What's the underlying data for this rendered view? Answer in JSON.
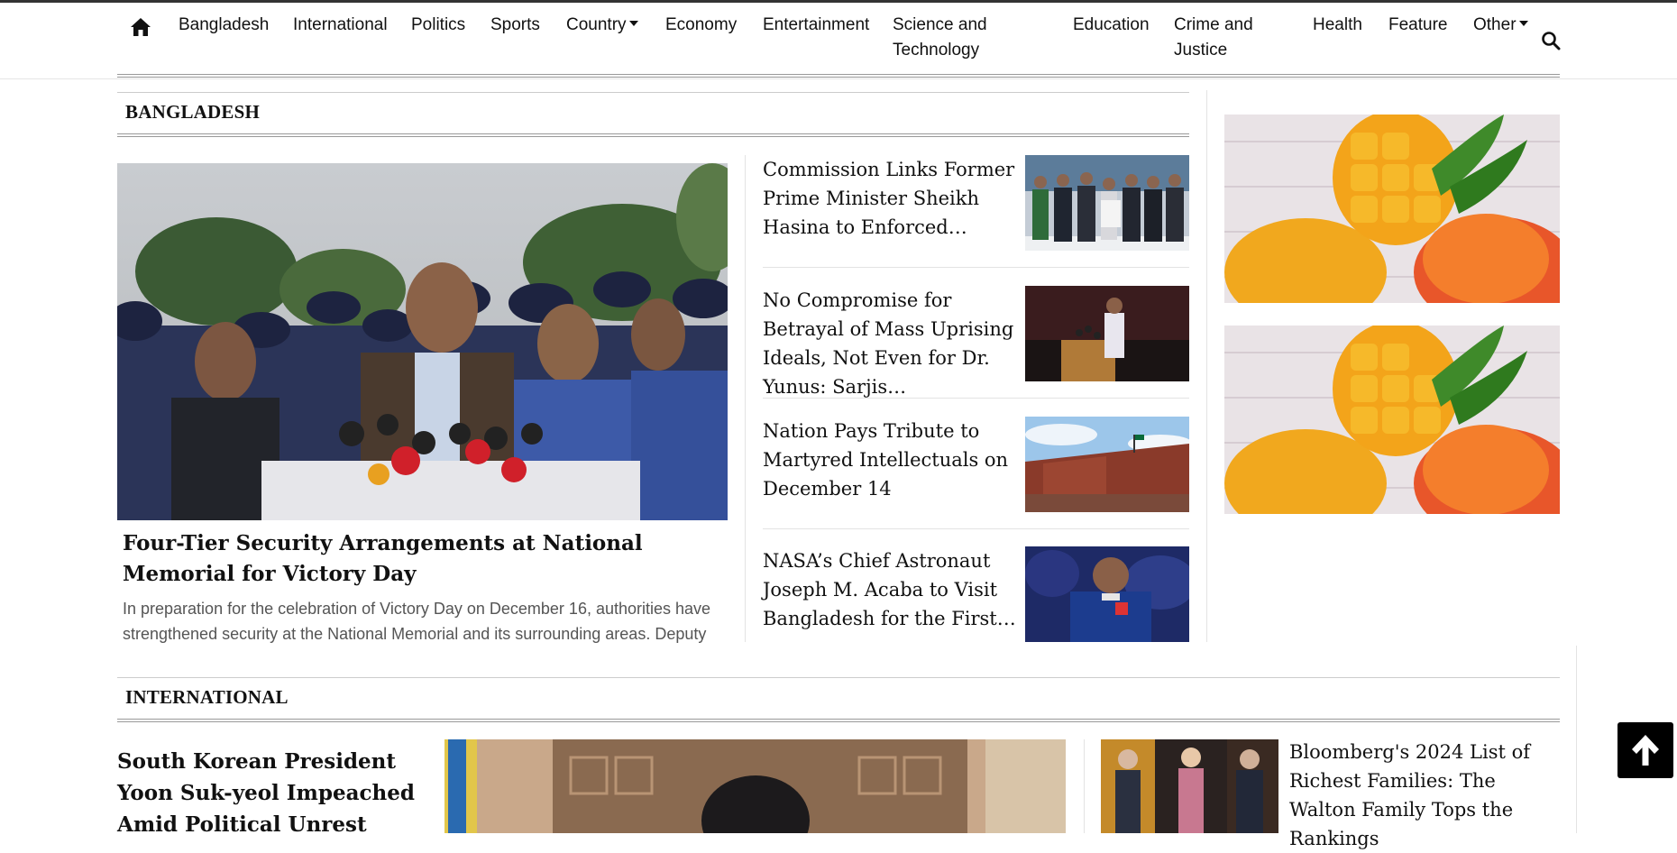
{
  "nav": {
    "items": [
      {
        "label": "Bangladesh"
      },
      {
        "label": "International"
      },
      {
        "label": "Politics"
      },
      {
        "label": "Sports"
      },
      {
        "label": "Country"
      },
      {
        "label": "Economy"
      },
      {
        "label": "Entertainment"
      },
      {
        "label": "Science and",
        "label2": "Technology"
      },
      {
        "label": "Education"
      },
      {
        "label": "Crime and",
        "label2": "Justice"
      },
      {
        "label": "Health"
      },
      {
        "label": "Feature"
      },
      {
        "label": "Other"
      }
    ]
  },
  "bangladesh": {
    "title": "BANGLADESH",
    "lead": {
      "headline": "Four-Tier Security Arrangements at National Memorial for Victory Day",
      "excerpt": "In preparation for the celebration of Victory Day on December 16, authorities have strengthened security at the National Memorial and its surrounding areas. Deputy"
    },
    "stories": [
      {
        "headline": "Commission Links Former Prime Minister Sheikh Hasina to Enforced…"
      },
      {
        "headline": "No Compromise for Betrayal of Mass Uprising Ideals, Not Even for Dr. Yunus: Sarjis…"
      },
      {
        "headline": "Nation Pays Tribute to Martyred Intellectuals on December 14"
      },
      {
        "headline": "NASA’s Chief Astronaut Joseph M. Acaba to Visit Bangladesh for the First…"
      }
    ]
  },
  "international": {
    "title": "INTERNATIONAL",
    "lead": {
      "headline": "South Korean President Yoon Suk-yeol Impeached Amid Political Unrest"
    },
    "side": {
      "headline": "Bloomberg's 2024 List of Richest Families: The Walton Family Tops the Rankings"
    }
  },
  "colors": {
    "accent": "#000000",
    "text": "#111111",
    "muted": "#555555"
  }
}
